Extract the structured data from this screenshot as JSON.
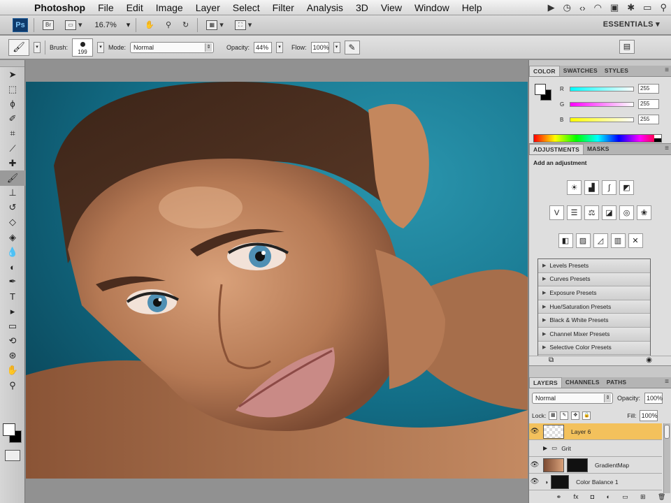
{
  "menubar": {
    "apple": "",
    "items": [
      "Photoshop",
      "File",
      "Edit",
      "Image",
      "Layer",
      "Select",
      "Filter",
      "Analysis",
      "3D",
      "View",
      "Window",
      "Help"
    ]
  },
  "appbar": {
    "logo": "Ps",
    "zoom": "16.7%",
    "workspace": "ESSENTIALS ▾"
  },
  "options": {
    "brush_label": "Brush:",
    "brush_size": "199",
    "mode_label": "Mode:",
    "mode_value": "Normal",
    "opacity_label": "Opacity:",
    "opacity_value": "44%",
    "flow_label": "Flow:",
    "flow_value": "100%"
  },
  "tools": [
    "move-tool",
    "marquee-tool",
    "lasso-tool",
    "quick-select-tool",
    "crop-tool",
    "eyedropper-tool",
    "healing-tool",
    "brush-tool",
    "clone-stamp-tool",
    "history-brush-tool",
    "eraser-tool",
    "paint-bucket-tool",
    "blur-tool",
    "dodge-tool",
    "pen-tool",
    "type-tool",
    "path-select-tool",
    "shape-tool",
    "3d-rotate-tool",
    "3d-orbit-tool",
    "hand-tool",
    "zoom-tool"
  ],
  "color_panel": {
    "tabs": [
      "COLOR",
      "SWATCHES",
      "STYLES"
    ],
    "channels": [
      {
        "label": "R",
        "value": "255"
      },
      {
        "label": "G",
        "value": "255"
      },
      {
        "label": "B",
        "value": "255"
      }
    ]
  },
  "adjustments_panel": {
    "tabs": [
      "ADJUSTMENTS",
      "MASKS"
    ],
    "title": "Add an adjustment",
    "presets": [
      "Levels Presets",
      "Curves Presets",
      "Exposure Presets",
      "Hue/Saturation Presets",
      "Black & White Presets",
      "Channel Mixer Presets",
      "Selective Color Presets"
    ]
  },
  "layers_panel": {
    "tabs": [
      "LAYERS",
      "CHANNELS",
      "PATHS"
    ],
    "blend_mode": "Normal",
    "opacity_label": "Opacity:",
    "opacity_value": "100%",
    "lock_label": "Lock:",
    "fill_label": "Fill:",
    "fill_value": "100%",
    "layers": [
      {
        "name": "Layer 6",
        "selected": true
      },
      {
        "name": "Grit",
        "selected": false
      },
      {
        "name": "GradientMap",
        "selected": false
      },
      {
        "name": "Color Balance 1",
        "selected": false
      }
    ]
  },
  "colors": {
    "canvas_bg": "#919191",
    "selection": "#f3c15c",
    "photo_bg": "#1b7892"
  }
}
